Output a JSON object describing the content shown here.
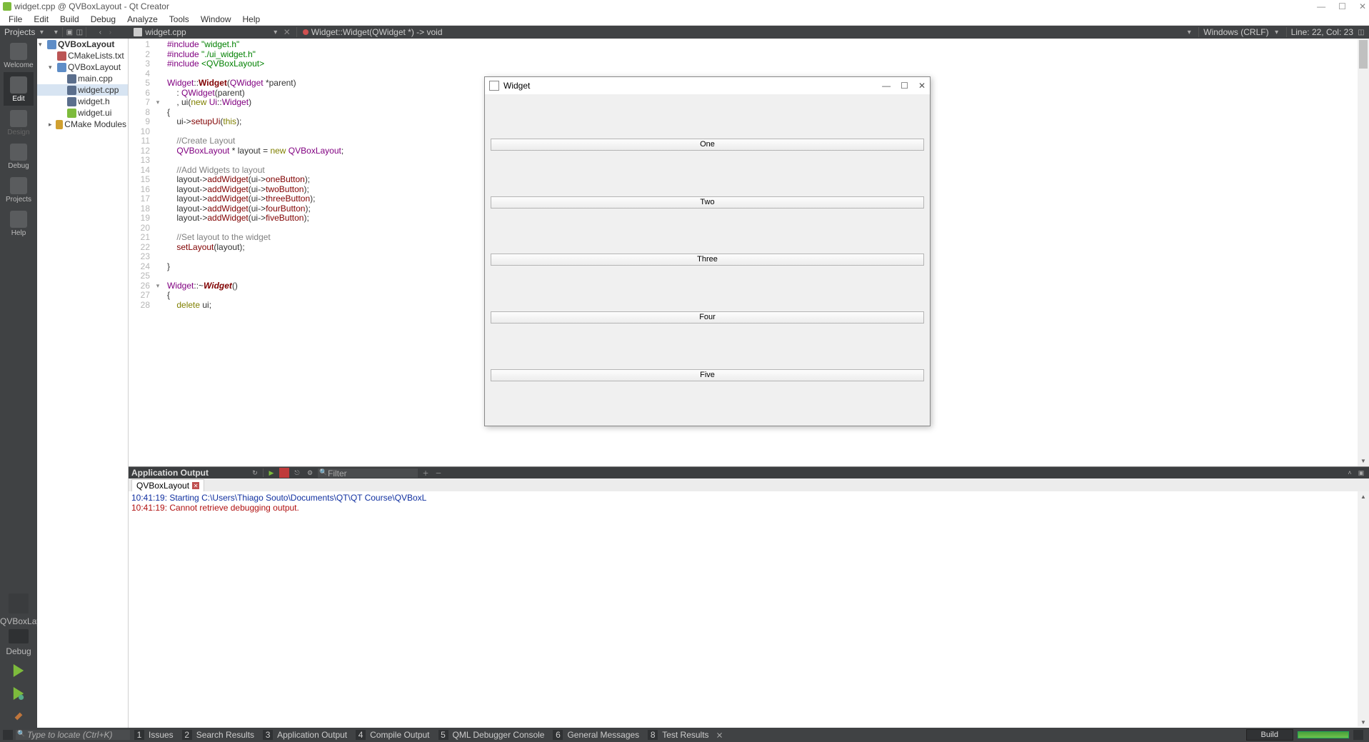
{
  "window_title": "widget.cpp @ QVBoxLayout - Qt Creator",
  "menu": [
    "File",
    "Edit",
    "Build",
    "Debug",
    "Analyze",
    "Tools",
    "Window",
    "Help"
  ],
  "toolbar": {
    "projects_label": "Projects",
    "open_file": "widget.cpp",
    "breadcrumb": "Widget::Widget(QWidget *) -> void",
    "line_ending": "Windows (CRLF)",
    "cursor": "Line: 22, Col: 23"
  },
  "leftbar": {
    "modes": [
      {
        "label": "Welcome",
        "active": false,
        "disabled": false
      },
      {
        "label": "Edit",
        "active": true,
        "disabled": false
      },
      {
        "label": "Design",
        "active": false,
        "disabled": true
      },
      {
        "label": "Debug",
        "active": false,
        "disabled": false
      },
      {
        "label": "Projects",
        "active": false,
        "disabled": false
      },
      {
        "label": "Help",
        "active": false,
        "disabled": false
      }
    ],
    "kit": "QVBoxLayout",
    "run_config": "Debug"
  },
  "project_tree": [
    {
      "indent": 0,
      "exp": "▾",
      "icon": "folder",
      "label": "QVBoxLayout",
      "bold": true
    },
    {
      "indent": 1,
      "exp": "",
      "icon": "cmake",
      "label": "CMakeLists.txt"
    },
    {
      "indent": 1,
      "exp": "▾",
      "icon": "folder",
      "label": "QVBoxLayout"
    },
    {
      "indent": 2,
      "exp": "",
      "icon": "cpp",
      "label": "main.cpp"
    },
    {
      "indent": 2,
      "exp": "",
      "icon": "cpp",
      "label": "widget.cpp",
      "selected": true
    },
    {
      "indent": 2,
      "exp": "",
      "icon": "h",
      "label": "widget.h"
    },
    {
      "indent": 2,
      "exp": "",
      "icon": "ui",
      "label": "widget.ui"
    },
    {
      "indent": 1,
      "exp": "▸",
      "icon": "mods",
      "label": "CMake Modules"
    }
  ],
  "code_lines": [
    {
      "n": 1,
      "fold": "",
      "html": "<span class='pre'>#include</span> <span class='str'>\"widget.h\"</span>"
    },
    {
      "n": 2,
      "fold": "",
      "html": "<span class='pre'>#include</span> <span class='str'>\"./ui_widget.h\"</span>"
    },
    {
      "n": 3,
      "fold": "",
      "html": "<span class='pre'>#include</span> <span class='str'>&lt;QVBoxLayout&gt;</span>"
    },
    {
      "n": 4,
      "fold": "",
      "html": ""
    },
    {
      "n": 5,
      "fold": "",
      "html": "<span class='ty'>Widget</span>::<span class='fn'><b>Widget</b></span>(<span class='ty'>QWidget</span> *parent)"
    },
    {
      "n": 6,
      "fold": "",
      "html": "    : <span class='ty'>QWidget</span>(parent)"
    },
    {
      "n": 7,
      "fold": "▾",
      "html": "    , ui(<span class='kw'>new</span> <span class='ty'>Ui</span>::<span class='ty'>Widget</span>)"
    },
    {
      "n": 8,
      "fold": "",
      "html": "{"
    },
    {
      "n": 9,
      "fold": "",
      "html": "    ui-&gt;<span class='fn'>setupUi</span>(<span class='kw'>this</span>);"
    },
    {
      "n": 10,
      "fold": "",
      "html": ""
    },
    {
      "n": 11,
      "fold": "",
      "html": "    <span class='cm'>//Create Layout</span>"
    },
    {
      "n": 12,
      "fold": "",
      "html": "    <span class='ty'>QVBoxLayout</span> * layout = <span class='kw'>new</span> <span class='ty'>QVBoxLayout</span>;"
    },
    {
      "n": 13,
      "fold": "",
      "html": ""
    },
    {
      "n": 14,
      "fold": "",
      "html": "    <span class='cm'>//Add Widgets to layout</span>"
    },
    {
      "n": 15,
      "fold": "",
      "html": "    layout-&gt;<span class='fn'>addWidget</span>(ui-&gt;<span class='fn'>oneButton</span>);"
    },
    {
      "n": 16,
      "fold": "",
      "html": "    layout-&gt;<span class='fn'>addWidget</span>(ui-&gt;<span class='fn'>twoButton</span>);"
    },
    {
      "n": 17,
      "fold": "",
      "html": "    layout-&gt;<span class='fn'>addWidget</span>(ui-&gt;<span class='fn'>threeButton</span>);"
    },
    {
      "n": 18,
      "fold": "",
      "html": "    layout-&gt;<span class='fn'>addWidget</span>(ui-&gt;<span class='fn'>fourButton</span>);"
    },
    {
      "n": 19,
      "fold": "",
      "html": "    layout-&gt;<span class='fn'>addWidget</span>(ui-&gt;<span class='fn'>fiveButton</span>);"
    },
    {
      "n": 20,
      "fold": "",
      "html": ""
    },
    {
      "n": 21,
      "fold": "",
      "html": "    <span class='cm'>//Set layout to the widget</span>"
    },
    {
      "n": 22,
      "fold": "",
      "html": "    <span class='fn'>setLayout</span>(layout);"
    },
    {
      "n": 23,
      "fold": "",
      "html": ""
    },
    {
      "n": 24,
      "fold": "",
      "html": "}"
    },
    {
      "n": 25,
      "fold": "",
      "html": ""
    },
    {
      "n": 26,
      "fold": "▾",
      "html": "<span class='ty'>Widget</span>::~<span class='fn'><b><i>Widget</i></b></span>()"
    },
    {
      "n": 27,
      "fold": "",
      "html": "{"
    },
    {
      "n": 28,
      "fold": "",
      "html": "    <span class='kw'>delete</span> ui;"
    }
  ],
  "output": {
    "panel_label": "Application Output",
    "filter_placeholder": "Filter",
    "tab": "QVBoxLayout",
    "lines": [
      {
        "cls": "t1",
        "text": "10:41:19: Starting C:\\Users\\Thiago Souto\\Documents\\QT\\QT Course\\QVBoxL"
      },
      {
        "cls": "t2",
        "text": "10:41:19: Cannot retrieve debugging output."
      }
    ]
  },
  "statusbar": {
    "locate_placeholder": "Type to locate (Ctrl+K)",
    "panes": [
      {
        "n": "1",
        "label": "Issues"
      },
      {
        "n": "2",
        "label": "Search Results"
      },
      {
        "n": "3",
        "label": "Application Output"
      },
      {
        "n": "4",
        "label": "Compile Output"
      },
      {
        "n": "5",
        "label": "QML Debugger Console"
      },
      {
        "n": "6",
        "label": "General Messages"
      },
      {
        "n": "8",
        "label": "Test Results"
      }
    ],
    "build_label": "Build"
  },
  "run_window": {
    "title": "Widget",
    "buttons": [
      "One",
      "Two",
      "Three",
      "Four",
      "Five"
    ]
  }
}
